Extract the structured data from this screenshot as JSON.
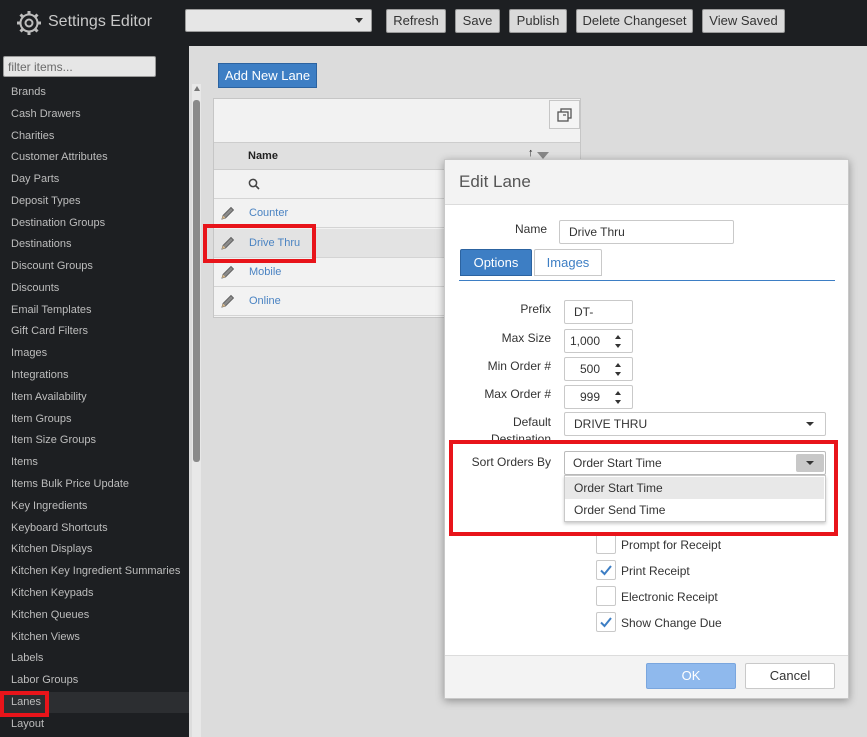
{
  "app": {
    "title": "Settings Editor"
  },
  "toolbar": {
    "changeset_value": "",
    "buttons": [
      "Refresh",
      "Save",
      "Publish",
      "Delete Changeset",
      "View Saved"
    ]
  },
  "sidebar": {
    "filter_placeholder": "filter items...",
    "items": [
      "Brands",
      "Cash Drawers",
      "Charities",
      "Customer Attributes",
      "Day Parts",
      "Deposit Types",
      "Destination Groups",
      "Destinations",
      "Discount Groups",
      "Discounts",
      "Email Templates",
      "Gift Card Filters",
      "Images",
      "Integrations",
      "Item Availability",
      "Item Groups",
      "Item Size Groups",
      "Items",
      "Items Bulk Price Update",
      "Key Ingredients",
      "Keyboard Shortcuts",
      "Kitchen Displays",
      "Kitchen Key Ingredient Summaries",
      "Kitchen Keypads",
      "Kitchen Queues",
      "Kitchen Views",
      "Labels",
      "Labor Groups",
      "Lanes",
      "Layout"
    ],
    "active_item": "Lanes"
  },
  "main": {
    "add_button": "Add New Lane",
    "grid": {
      "column_name": "Name",
      "sort_arrow": "↑",
      "rows": [
        "Counter",
        "Drive Thru",
        "Mobile",
        "Online"
      ],
      "selected_row": "Drive Thru"
    }
  },
  "dialog": {
    "title": "Edit Lane",
    "name_label": "Name",
    "name_value": "Drive Thru",
    "tabs": [
      "Options",
      "Images"
    ],
    "active_tab": "Options",
    "fields": {
      "prefix_label": "Prefix",
      "prefix_value": "DT-",
      "max_size_label": "Max Size",
      "max_size_value": "1,000",
      "min_order_label": "Min Order #",
      "min_order_value": "500",
      "max_order_label": "Max Order #",
      "max_order_value": "999",
      "default_destination_label_1": "Default",
      "default_destination_label_2": "Destination",
      "default_destination_value": "DRIVE THRU",
      "sort_orders_label": "Sort Orders By",
      "sort_orders_value": "Order Start Time"
    },
    "sort_options": [
      "Order Start Time",
      "Order Send Time"
    ],
    "checkboxes": [
      {
        "label": "Prompt for Receipt",
        "checked": false
      },
      {
        "label": "Print Receipt",
        "checked": true
      },
      {
        "label": "Electronic Receipt",
        "checked": false
      },
      {
        "label": "Show Change Due",
        "checked": true
      }
    ],
    "ok_label": "OK",
    "cancel_label": "Cancel"
  },
  "colors": {
    "accent": "#3d7ec4",
    "highlight_box": "#e8141a",
    "sidebar_bg": "#1d1f22"
  }
}
